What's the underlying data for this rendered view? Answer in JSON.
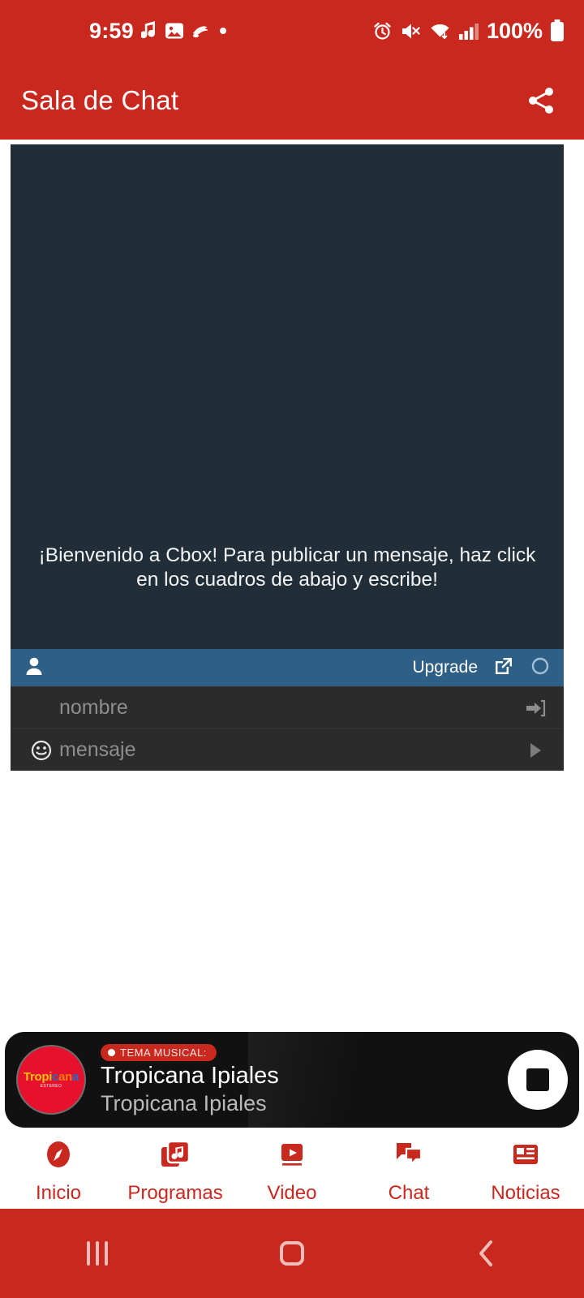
{
  "status_bar": {
    "time": "9:59",
    "battery_percent": "100%",
    "left_icons": [
      "music-note-icon",
      "image-icon",
      "app-icon",
      "dot-icon"
    ],
    "right_icons": [
      "alarm-icon",
      "mute-vibrate-icon",
      "wifi-icon",
      "signal-icon",
      "battery-icon"
    ]
  },
  "app_bar": {
    "title": "Sala de Chat",
    "share_icon": "share-icon"
  },
  "chat_widget": {
    "welcome_message": "¡Bienvenido a Cbox! Para publicar un mensaje, haz click en los cuadros de abajo y escribe!",
    "toolbar": {
      "user_icon": "user-icon",
      "upgrade_label": "Upgrade",
      "popout_icon": "external-link-icon",
      "refresh_icon": "circle-icon"
    },
    "name_field": {
      "placeholder": "nombre",
      "submit_icon": "login-arrow-icon"
    },
    "message_field": {
      "placeholder": "mensaje",
      "emoji_icon": "smiley-icon",
      "send_icon": "send-triangle-icon"
    }
  },
  "player": {
    "logo_text": "Tropicana",
    "logo_subtext": "ESTEREO",
    "badge_label": "TEMA MUSICAL:",
    "title": "Tropicana Ipiales",
    "subtitle": "Tropicana Ipiales",
    "stop_button_icon": "stop-icon"
  },
  "bottom_nav": {
    "items": [
      {
        "label": "Inicio",
        "icon": "compass-icon"
      },
      {
        "label": "Programas",
        "icon": "music-library-icon"
      },
      {
        "label": "Video",
        "icon": "video-play-icon"
      },
      {
        "label": "Chat",
        "icon": "chat-bubbles-icon"
      },
      {
        "label": "Noticias",
        "icon": "news-icon"
      }
    ]
  },
  "android_nav": {
    "recents_icon": "recents-icon",
    "home_icon": "home-icon",
    "back_icon": "back-icon"
  },
  "colors": {
    "brand_red": "#c9281e",
    "chat_bg": "#212e38",
    "toolbar_blue": "#2e5f87",
    "input_bg": "#2b2b2b"
  }
}
